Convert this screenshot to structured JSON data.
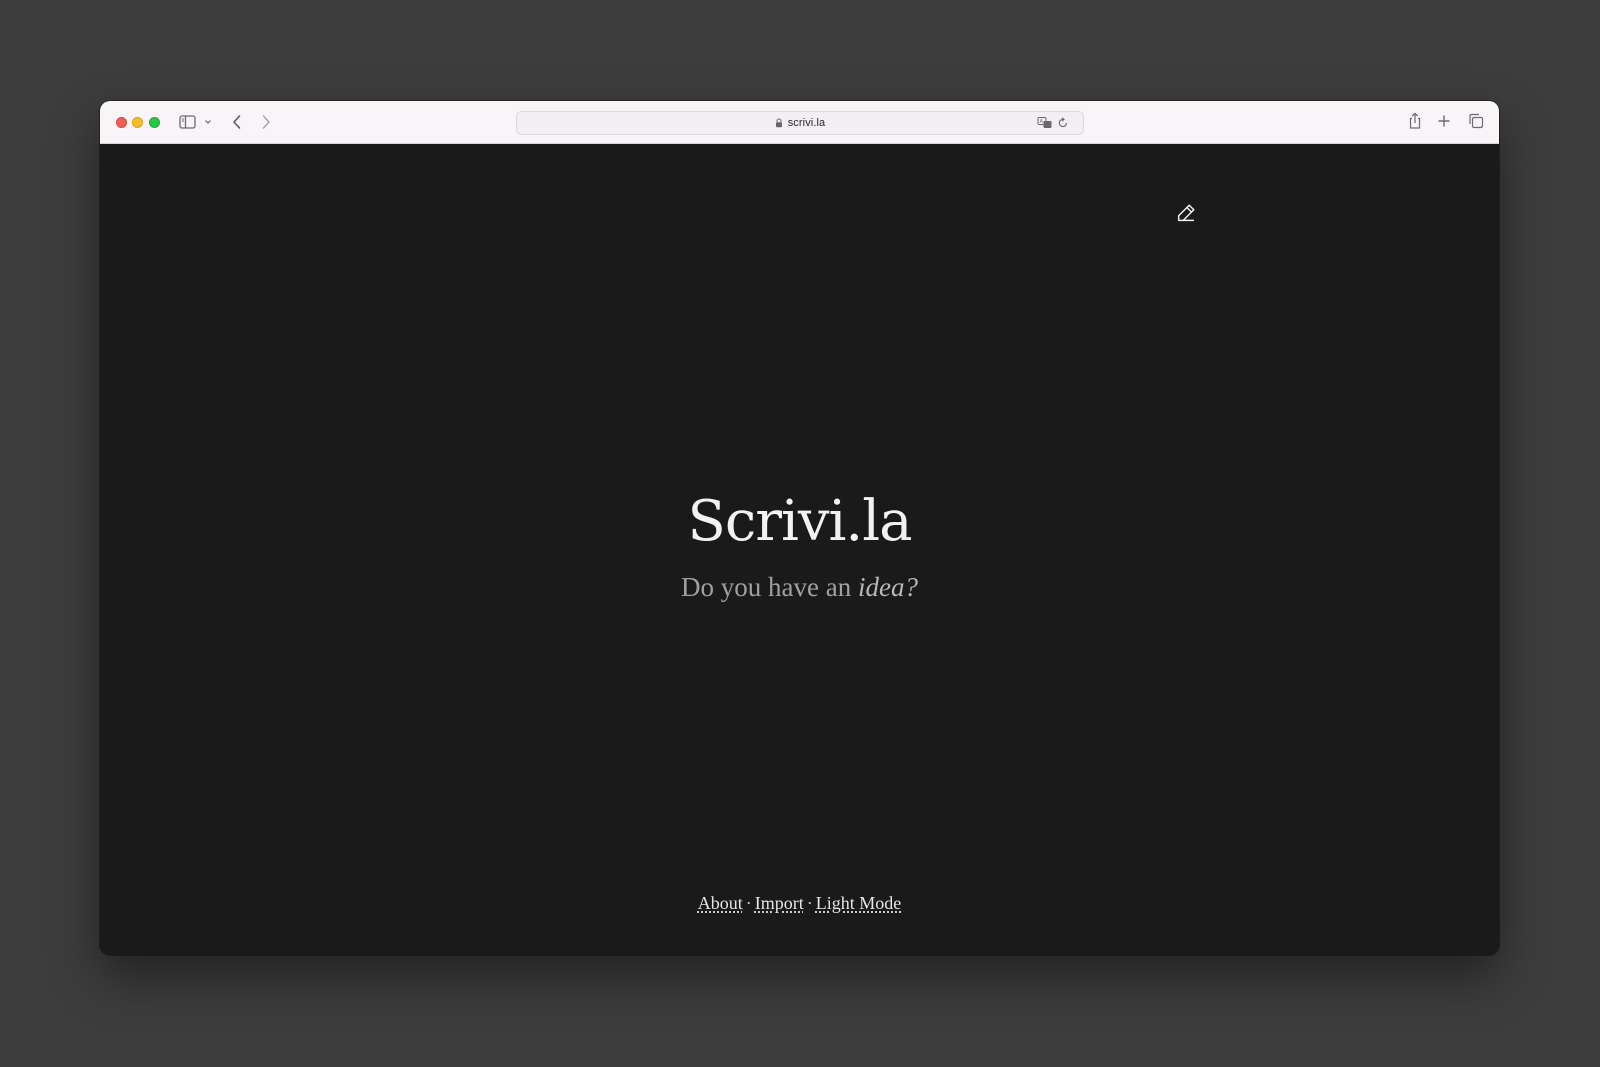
{
  "browser": {
    "url": "scrivi.la",
    "icons": {
      "sidebar": "sidebar-icon",
      "sidebar_menu": "chevron-down-icon",
      "back": "chevron-left-icon",
      "forward": "chevron-right-icon",
      "lock": "lock-icon",
      "translate": "translate-icon",
      "reload": "reload-icon",
      "share": "share-icon",
      "new_tab": "plus-icon",
      "tab_overview": "tabs-overview-icon"
    }
  },
  "page": {
    "title": "Scrivi.la",
    "subtitle_prefix": "Do you have an ",
    "subtitle_emphasis": "idea?",
    "edit_icon": "pencil-icon",
    "footer": {
      "links": [
        "About",
        "Import",
        "Light Mode"
      ],
      "separator": "·"
    },
    "colors": {
      "background": "#1a1a1a",
      "title": "#f2f2f2",
      "subtitle": "#a0a0a0"
    }
  }
}
